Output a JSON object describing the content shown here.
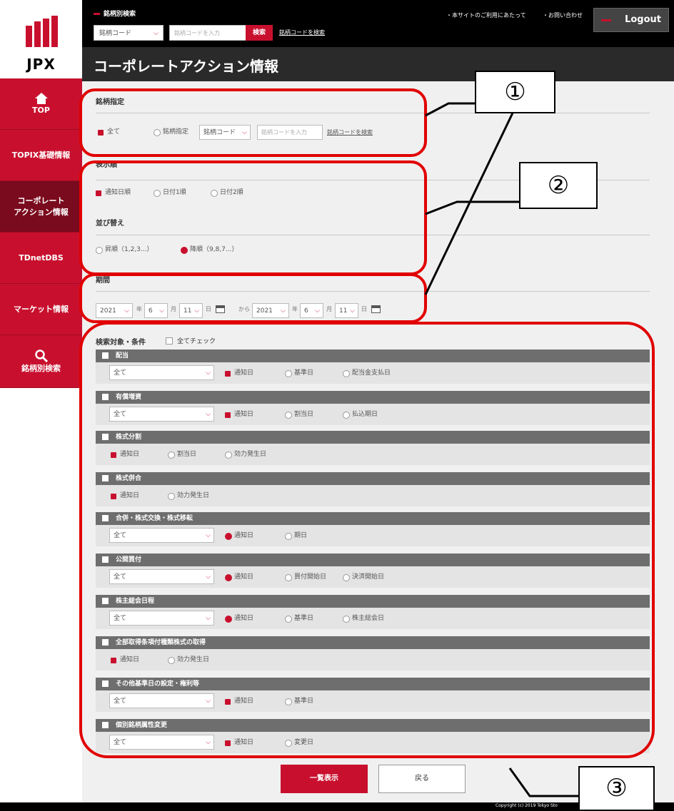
{
  "logo": {
    "text": "JPX"
  },
  "sidebar": {
    "items": [
      {
        "label": "TOP"
      },
      {
        "label": "TOPIX基礎情報"
      },
      {
        "label1": "コーポレート",
        "label2": "アクション情報"
      },
      {
        "label": "TDnetDBS"
      },
      {
        "label": "マーケット情報"
      },
      {
        "label": "銘柄別検索"
      }
    ]
  },
  "topbar": {
    "title": "銘柄別検索",
    "code_select": "銘柄コード",
    "code_placeholder": "銘柄コードを入力",
    "search_label": "検索",
    "code_link": "銘柄コードを検索",
    "util1": "・本サイトのご利用にあたって",
    "util2": "・お問い合わせ",
    "logout": "Logout"
  },
  "header": {
    "title": "コーポレートアクション情報"
  },
  "stock": {
    "title": "銘柄指定",
    "opt_all": "全て",
    "opt_specify": "銘柄指定",
    "select": "銘柄コード",
    "input_placeholder": "銘柄コードを入力",
    "link": "銘柄コードを検索"
  },
  "display_order": {
    "title": "表示順",
    "opt1": "通知日順",
    "opt2": "日付1順",
    "opt3": "日付2順"
  },
  "sort": {
    "title": "並び替え",
    "asc": "昇順（1,2,3...）",
    "desc": "降順（9,8,7...）"
  },
  "period": {
    "title": "期間",
    "from_year": "2021",
    "from_month": "6",
    "from_day": "11",
    "to_year": "2021",
    "to_month": "6",
    "to_day": "11",
    "year_unit": "年",
    "month_unit": "月",
    "day_unit": "日",
    "from_word": "から"
  },
  "targets": {
    "title": "検索対象・条件",
    "check_all": "全てチェック"
  },
  "categories": [
    {
      "name": "配当",
      "select": "全て",
      "options": [
        "通知日",
        "基準日",
        "配当金支払日"
      ]
    },
    {
      "name": "有償増資",
      "select": "全て",
      "options": [
        "通知日",
        "割当日",
        "払込期日"
      ]
    },
    {
      "name": "株式分割",
      "select": "",
      "options": [
        "通知日",
        "割当日",
        "効力発生日"
      ]
    },
    {
      "name": "株式併合",
      "select": "",
      "options": [
        "通知日",
        "効力発生日"
      ]
    },
    {
      "name": "合併・株式交換・株式移転",
      "select": "全て",
      "options": [
        "通知日",
        "期日"
      ]
    },
    {
      "name": "公開買付",
      "select": "全て",
      "options": [
        "通知日",
        "買付開始日",
        "決済開始日"
      ]
    },
    {
      "name": "株主総会日程",
      "select": "全て",
      "options": [
        "通知日",
        "基準日",
        "株主総会日"
      ]
    },
    {
      "name": "全部取得条項付種類株式の取得",
      "select": "",
      "options": [
        "通知日",
        "効力発生日"
      ]
    },
    {
      "name": "その他基準日の設定・権利等",
      "select": "全て",
      "options": [
        "通知日",
        "基準日"
      ]
    },
    {
      "name": "個別銘柄属性変更",
      "select": "全て",
      "options": [
        "通知日",
        "変更日"
      ]
    }
  ],
  "buttons": {
    "show": "一覧表示",
    "back": "戻る"
  },
  "footer": {
    "copyright": "Copyright (c) 2019 Tokyo Sto"
  },
  "annotations": {
    "n1": "①",
    "n2": "②",
    "n3": "③"
  },
  "colors": {
    "brand_red": "#c8102e",
    "annotation_red": "#e10000",
    "header_dark": "#2a2a2a"
  }
}
